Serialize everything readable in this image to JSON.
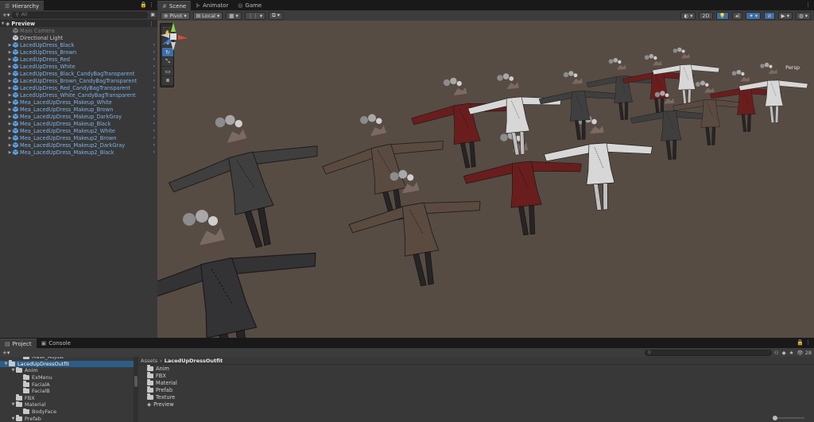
{
  "hierarchy": {
    "tab_label": "Hierarchy",
    "add_label": "+▾",
    "search_placeholder": "All",
    "root": "Preview",
    "items": [
      {
        "label": "Main Camera",
        "kind": "disabled"
      },
      {
        "label": "Directional Light",
        "kind": "object"
      },
      {
        "label": "LacedUpDress_Black",
        "kind": "prefab"
      },
      {
        "label": "LacedUpDress_Brown",
        "kind": "prefab"
      },
      {
        "label": "LacedUpDress_Red",
        "kind": "prefab"
      },
      {
        "label": "LacedUpDress_White",
        "kind": "prefab"
      },
      {
        "label": "LacedUpDress_Black_CandyBagTransparent",
        "kind": "prefab"
      },
      {
        "label": "LacedUpDress_Brown_CandyBagTransparent",
        "kind": "prefab"
      },
      {
        "label": "LacedUpDress_Red_CandyBagTransparent",
        "kind": "prefab"
      },
      {
        "label": "LacedUpDress_White_CandyBagTransparent",
        "kind": "prefab"
      },
      {
        "label": "Mea_LacedUpDress_Makeup_White",
        "kind": "prefab"
      },
      {
        "label": "Mea_LacedUpDress_Makeup_Brown",
        "kind": "prefab"
      },
      {
        "label": "Mea_LacedUpDress_Makeup_DarkGray",
        "kind": "prefab"
      },
      {
        "label": "Mea_LacedUpDress_Makeup_Black",
        "kind": "prefab"
      },
      {
        "label": "Mea_LacedUpDress_Makeup2_White",
        "kind": "prefab"
      },
      {
        "label": "Mea_LacedUpDress_Makeup2_Brown",
        "kind": "prefab"
      },
      {
        "label": "Mea_LacedUpDress_Makeup2_DarkGray",
        "kind": "prefab"
      },
      {
        "label": "Mea_LacedUpDress_Makeup2_Black",
        "kind": "prefab"
      }
    ]
  },
  "scene": {
    "tabs": [
      {
        "label": "Scene",
        "icon": "scene-icon"
      },
      {
        "label": "Animator",
        "icon": "animator-icon"
      },
      {
        "label": "Game",
        "icon": "game-icon"
      }
    ],
    "pivot": "Pivot",
    "space": "Local",
    "mode_2d": "2D",
    "persp_label": "Persp",
    "tools": [
      "view-tool",
      "move-tool",
      "rotate-tool",
      "scale-tool",
      "rect-tool",
      "transform-tool"
    ],
    "selected_tool": "rotate-tool"
  },
  "project": {
    "tabs": [
      "Project",
      "Console"
    ],
    "add_label": "+▾",
    "hidden_count": "28",
    "tree": [
      {
        "label": "Mask_Adjust",
        "depth": 2,
        "arrow": ""
      },
      {
        "label": "LacedUpDressOutfit",
        "depth": 0,
        "arrow": "▼",
        "selected": true
      },
      {
        "label": "Anim",
        "depth": 1,
        "arrow": "▼"
      },
      {
        "label": "ExMenu",
        "depth": 2,
        "arrow": ""
      },
      {
        "label": "FacialA",
        "depth": 2,
        "arrow": ""
      },
      {
        "label": "FacialB",
        "depth": 2,
        "arrow": ""
      },
      {
        "label": "FBX",
        "depth": 1,
        "arrow": ""
      },
      {
        "label": "Material",
        "depth": 1,
        "arrow": "▼"
      },
      {
        "label": "BodyFace",
        "depth": 2,
        "arrow": ""
      },
      {
        "label": "Prefab",
        "depth": 1,
        "arrow": "▼"
      }
    ],
    "breadcrumb": [
      "Assets",
      "LacedUpDressOutfit"
    ],
    "assets": [
      {
        "label": "Anim",
        "kind": "folder"
      },
      {
        "label": "FBX",
        "kind": "folder"
      },
      {
        "label": "Material",
        "kind": "folder"
      },
      {
        "label": "Prefab",
        "kind": "folder"
      },
      {
        "label": "Texture",
        "kind": "folder"
      },
      {
        "label": "Preview",
        "kind": "scene"
      }
    ]
  },
  "colors": {
    "black": "#3f3f3f",
    "brown": "#5a4a40",
    "red": "#6a1d1d",
    "white": "#d7d7d7",
    "darkgray": "#333336"
  }
}
